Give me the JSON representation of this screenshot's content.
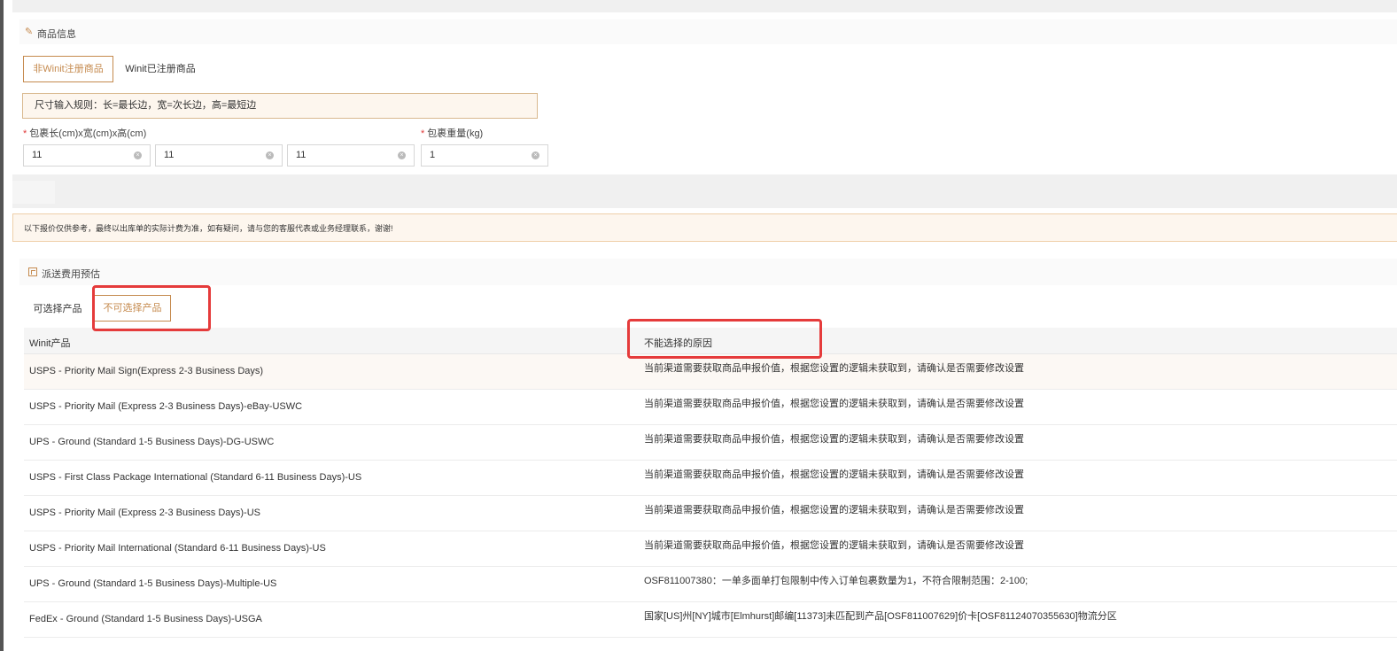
{
  "goods_section": {
    "title": "商品信息",
    "icon": "brush-icon"
  },
  "product_tabs": [
    {
      "label": "非Winit注册商品",
      "active": true
    },
    {
      "label": "Winit已注册商品",
      "active": false
    }
  ],
  "size_rule": "尺寸输入规则：长=最长边，宽=次长边，高=最短边",
  "fields": {
    "dimensions_label": "包裹长(cm)x宽(cm)x高(cm)",
    "weight_label": "包裹重量(kg)",
    "length": "11",
    "width": "11",
    "height": "11",
    "weight": "1"
  },
  "notice": "以下报价仅供参考，最终以出库单的实际计费为准，如有疑问，请与您的客服代表或业务经理联系，谢谢!",
  "estimate_section": {
    "title": "派送费用预估",
    "icon": "calculator-icon"
  },
  "result_tabs": [
    {
      "label": "可选择产品",
      "active": false
    },
    {
      "label": "不可选择产品",
      "active": true
    }
  ],
  "table": {
    "headers": [
      "Winit产品",
      "不能选择的原因"
    ],
    "rows": [
      {
        "product": "USPS - Priority Mail Sign(Express 2-3 Business Days)",
        "reason": "当前渠道需要获取商品申报价值，根据您设置的逻辑未获取到，请确认是否需要修改设置"
      },
      {
        "product": "USPS - Priority Mail (Express 2-3 Business Days)-eBay-USWC",
        "reason": "当前渠道需要获取商品申报价值，根据您设置的逻辑未获取到，请确认是否需要修改设置"
      },
      {
        "product": "UPS - Ground (Standard 1-5 Business Days)-DG-USWC",
        "reason": "当前渠道需要获取商品申报价值，根据您设置的逻辑未获取到，请确认是否需要修改设置"
      },
      {
        "product": "USPS - First Class Package International (Standard 6-11 Business Days)-US",
        "reason": "当前渠道需要获取商品申报价值，根据您设置的逻辑未获取到，请确认是否需要修改设置"
      },
      {
        "product": "USPS - Priority Mail (Express 2-3 Business Days)-US",
        "reason": "当前渠道需要获取商品申报价值，根据您设置的逻辑未获取到，请确认是否需要修改设置"
      },
      {
        "product": "USPS - Priority Mail International (Standard 6-11 Business Days)-US",
        "reason": "当前渠道需要获取商品申报价值，根据您设置的逻辑未获取到，请确认是否需要修改设置"
      },
      {
        "product": "UPS - Ground (Standard 1-5 Business Days)-Multiple-US",
        "reason": "OSF811007380：一单多面单打包限制中传入订单包裹数量为1，不符合限制范围：2-100;"
      },
      {
        "product": "FedEx - Ground (Standard 1-5 Business Days)-USGA",
        "reason": "国家[US]州[NY]城市[Elmhurst]邮编[11373]未匹配到产品[OSF811007629]价卡[OSF81124070355630]物流分区"
      }
    ]
  },
  "colors": {
    "accent": "#c58a4e",
    "highlight": "#e53b3b",
    "notice_bg": "#fdf6ee"
  }
}
